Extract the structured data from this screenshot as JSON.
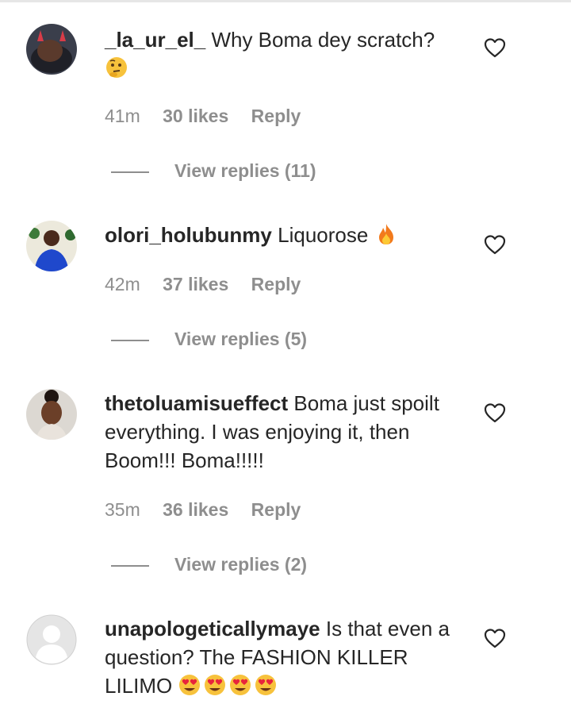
{
  "comments": [
    {
      "username": "_la_ur_el_",
      "text": "Why Boma dey scratch?",
      "emojis": [
        "thinking-face"
      ],
      "time": "41m",
      "likes": "30 likes",
      "reply": "Reply",
      "view_replies": "View replies (11)",
      "avatar_colors": [
        "#2b2d36",
        "#c83c46"
      ]
    },
    {
      "username": "olori_holubunmy",
      "text": "Liquorose",
      "emojis": [
        "fire"
      ],
      "time": "42m",
      "likes": "37 likes",
      "reply": "Reply",
      "view_replies": "View replies (5)",
      "avatar_colors": [
        "#e7e4d6",
        "#1d44c8"
      ]
    },
    {
      "username": "thetoluamisueffect",
      "text": "Boma just spoilt everything. I was enjoying it, then Boom!!! Boma!!!!!",
      "emojis": [],
      "time": "35m",
      "likes": "36 likes",
      "reply": "Reply",
      "view_replies": "View replies (2)",
      "avatar_colors": [
        "#d8d4ce",
        "#5a3524"
      ]
    },
    {
      "username": "unapologeticallymaye",
      "text": "Is that even a question? The FASHION KILLER LILIMO",
      "emojis": [
        "heart-eyes",
        "heart-eyes",
        "heart-eyes",
        "heart-eyes"
      ],
      "avatar_colors": [
        "#e5e5e5",
        "#ffffff"
      ]
    }
  ],
  "colors": {
    "text": "#262626",
    "secondary": "#8e8e8e"
  }
}
